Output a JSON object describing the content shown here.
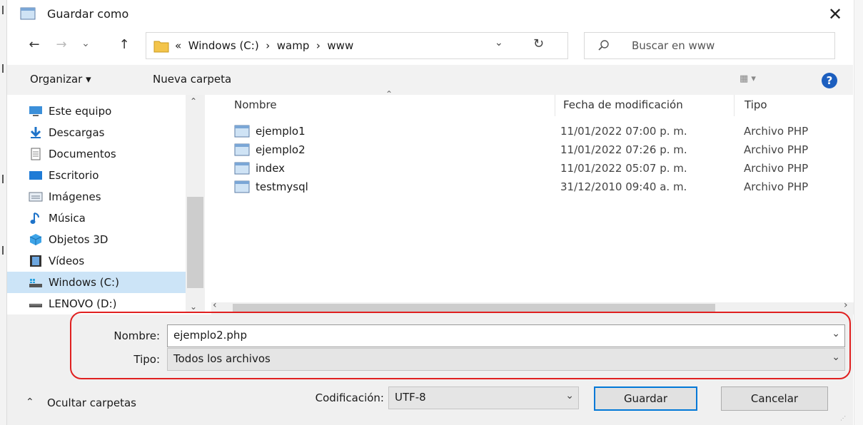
{
  "window": {
    "title": "Guardar como",
    "close_glyph": "✕"
  },
  "nav": {
    "back_glyph": "←",
    "forward_glyph": "→",
    "recent_glyph": "⌄",
    "up_glyph": "↑",
    "address_path": "«  Windows (C:)  ›  wamp  ›  www",
    "address_dropdown_glyph": "⌄",
    "refresh_glyph": "↻",
    "search_placeholder": "Buscar en www"
  },
  "toolbar": {
    "organize_label": "Organizar ▾",
    "new_folder_label": "Nueva carpeta",
    "view_glyph": "▦ ▾",
    "help_glyph": "?"
  },
  "sidebar": {
    "items": [
      {
        "label": "Este equipo",
        "icon": "computer-icon"
      },
      {
        "label": "Descargas",
        "icon": "download-icon"
      },
      {
        "label": "Documentos",
        "icon": "documents-icon"
      },
      {
        "label": "Escritorio",
        "icon": "desktop-icon"
      },
      {
        "label": "Imágenes",
        "icon": "pictures-icon"
      },
      {
        "label": "Música",
        "icon": "music-icon"
      },
      {
        "label": "Objetos 3D",
        "icon": "objects-3d-icon"
      },
      {
        "label": "Vídeos",
        "icon": "videos-icon"
      },
      {
        "label": "Windows (C:)",
        "icon": "drive-c-icon",
        "selected": true
      },
      {
        "label": "LENOVO (D:)",
        "icon": "drive-d-icon"
      }
    ]
  },
  "file_list": {
    "columns": [
      "Nombre",
      "Fecha de modificación",
      "Tipo"
    ],
    "rows": [
      {
        "name": "ejemplo1",
        "date": "11/01/2022 07:00 p. m.",
        "type": "Archivo PHP"
      },
      {
        "name": "ejemplo2",
        "date": "11/01/2022 07:26 p. m.",
        "type": "Archivo PHP"
      },
      {
        "name": "index",
        "date": "11/01/2022 05:07 p. m.",
        "type": "Archivo PHP"
      },
      {
        "name": "testmysql",
        "date": "31/12/2010 09:40 a. m.",
        "type": "Archivo PHP"
      }
    ]
  },
  "form": {
    "filename_label": "Nombre:",
    "filename_value": "ejemplo2.php",
    "type_label": "Tipo:",
    "type_value": "Todos los archivos",
    "encoding_label": "Codificación:",
    "encoding_value": "UTF-8",
    "hide_folders_label": "Ocultar carpetas",
    "save_label": "Guardar",
    "cancel_label": "Cancelar"
  },
  "colors": {
    "highlight": "#e02020",
    "selected_bg": "#cce4f7",
    "primary_border": "#0078d7"
  }
}
